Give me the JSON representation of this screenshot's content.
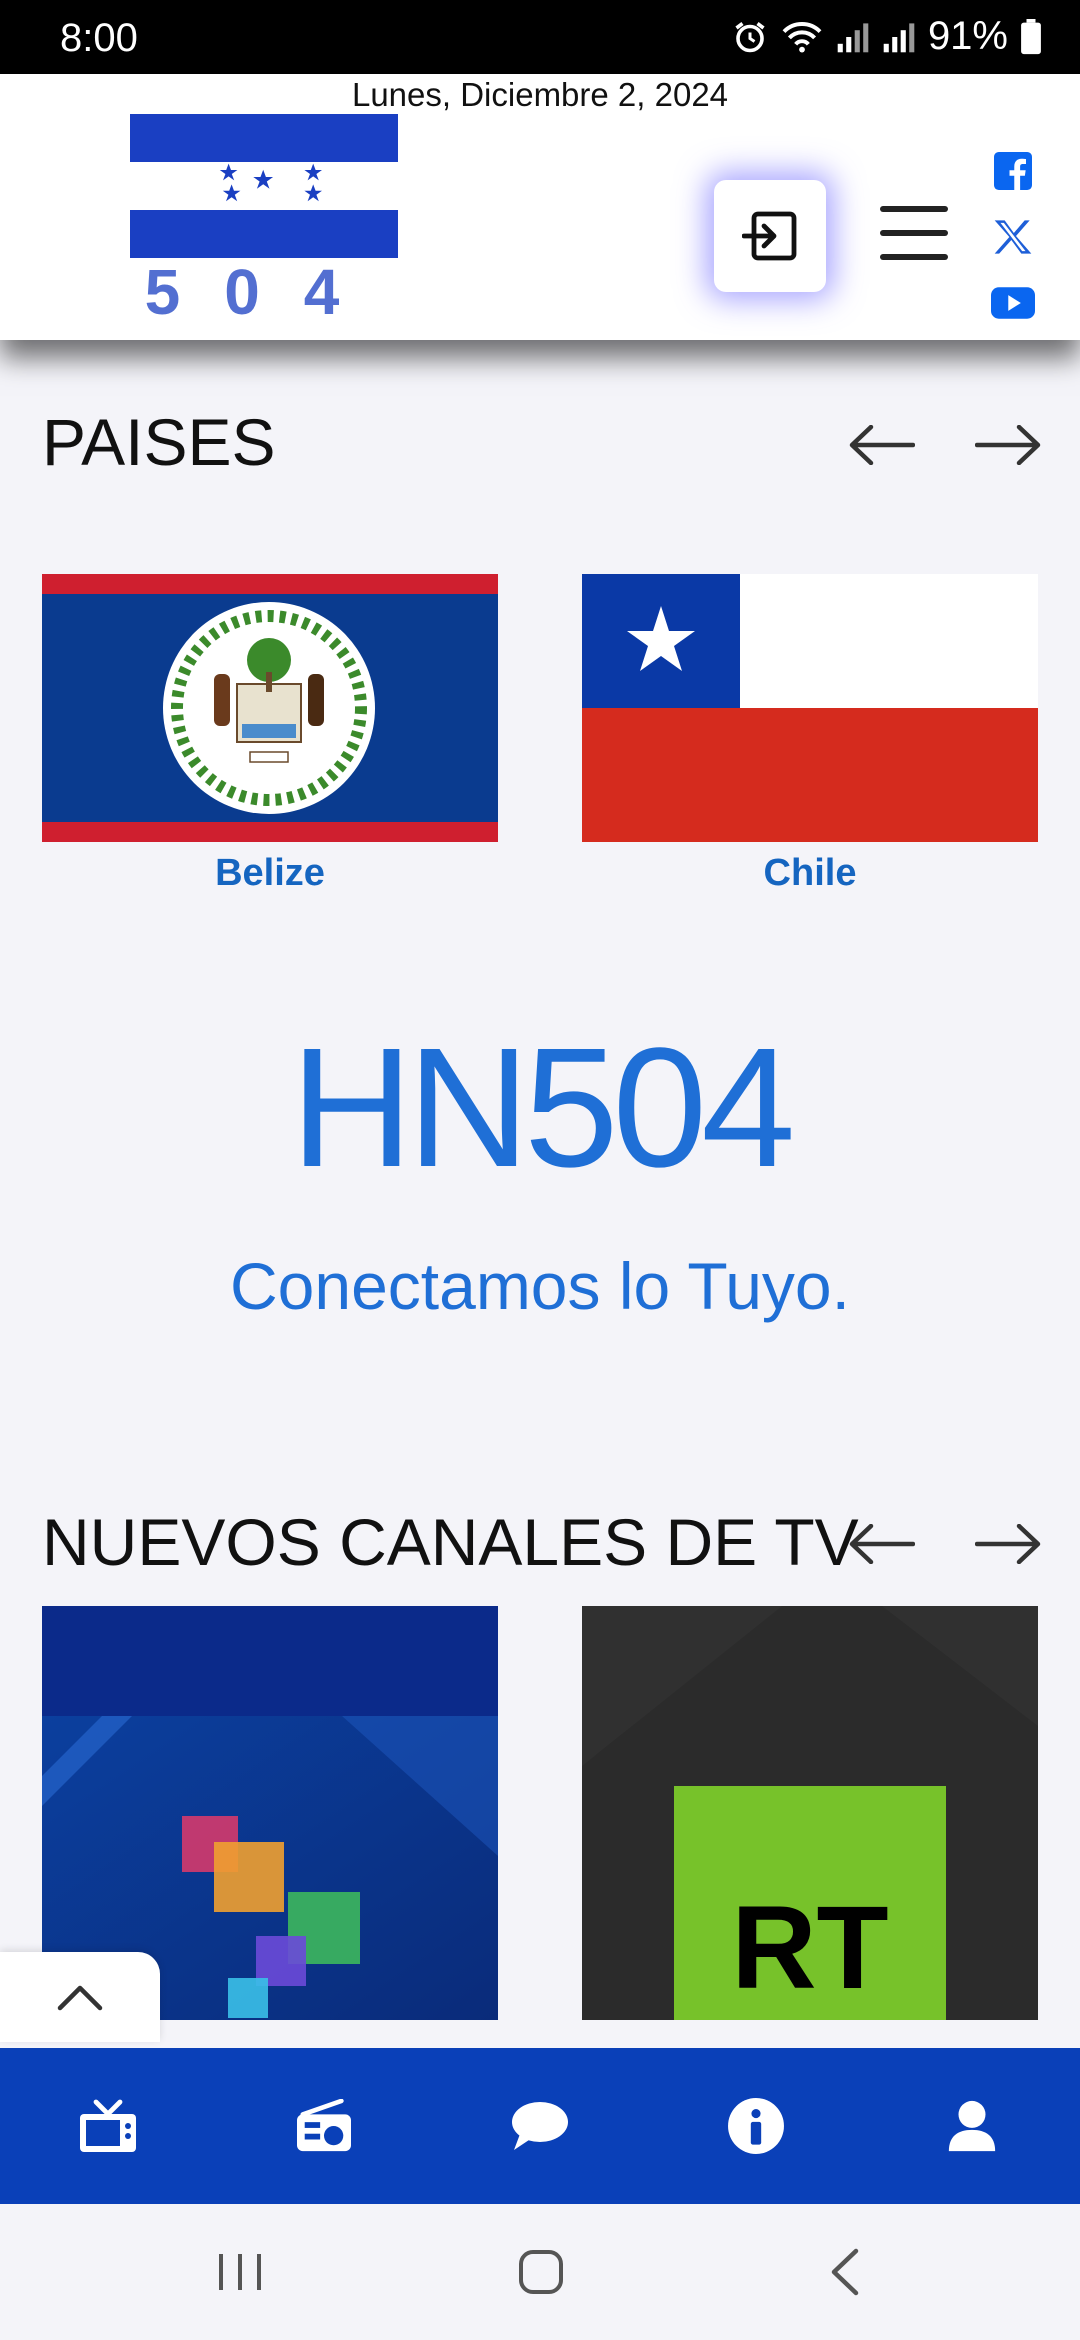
{
  "status_bar": {
    "time": "8:00",
    "battery": "91%",
    "icons": [
      "alarm-icon",
      "wifi-icon",
      "signal-icon",
      "signal-icon",
      "battery-icon"
    ]
  },
  "header": {
    "date": "Lunes, Diciembre 2, 2024",
    "logo_text": "504",
    "social": [
      "facebook-icon",
      "x-icon",
      "youtube-icon"
    ],
    "accent_color": "#1565c0"
  },
  "countries": {
    "title": "PAISES",
    "items": [
      {
        "label": "Belize"
      },
      {
        "label": "Chile"
      }
    ]
  },
  "brand": {
    "name": "HN504",
    "tagline": "Conectamos lo Tuyo.",
    "color": "#1f6fd6"
  },
  "tv_channels": {
    "title": "NUEVOS CANALES DE TV",
    "items": [
      {
        "logo": "abstract-tiles"
      },
      {
        "logo_text": "RT"
      }
    ]
  },
  "bottom_nav": {
    "color": "#0a40b8",
    "items": [
      "tv-icon",
      "radio-icon",
      "chat-icon",
      "info-icon",
      "user-icon"
    ]
  },
  "system_nav": [
    "recent-apps-button",
    "home-button",
    "back-button"
  ]
}
